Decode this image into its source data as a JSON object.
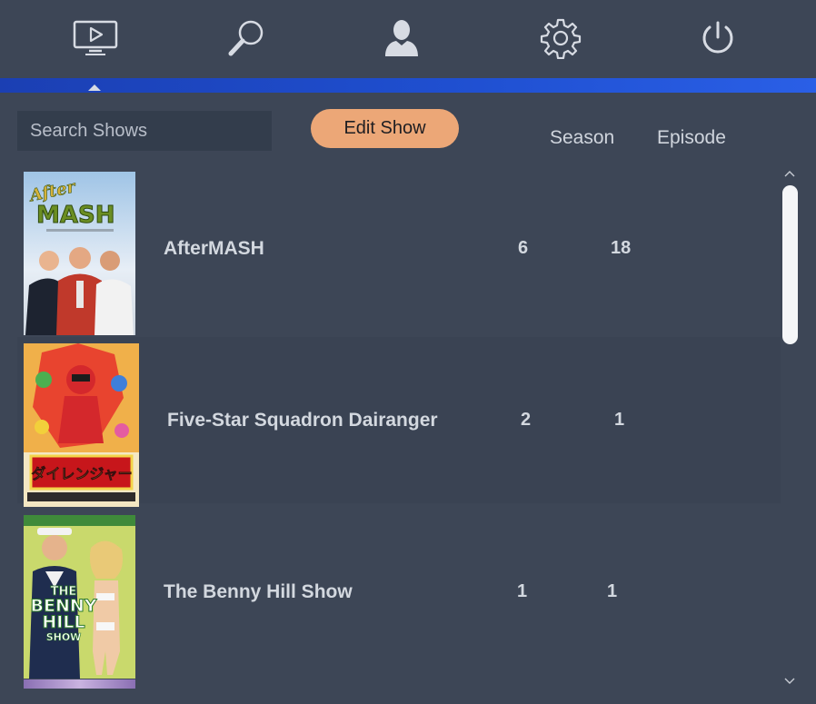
{
  "nav": {
    "items": [
      {
        "name": "tv-shows",
        "icon": "tv-play-icon",
        "active": true
      },
      {
        "name": "search",
        "icon": "magnifier-icon",
        "active": false
      },
      {
        "name": "profile",
        "icon": "user-icon",
        "active": false
      },
      {
        "name": "settings",
        "icon": "gear-icon",
        "active": false
      },
      {
        "name": "power",
        "icon": "power-icon",
        "active": false
      }
    ],
    "accent_color": "#1f4fd0"
  },
  "toolbar": {
    "search_placeholder": "Search Shows",
    "edit_label": "Edit Show",
    "edit_color": "#eca777"
  },
  "columns": {
    "season": "Season",
    "episode": "Episode"
  },
  "shows": [
    {
      "title": "AfterMASH",
      "season": "6",
      "episode": "18",
      "poster_icon": "aftermash-poster"
    },
    {
      "title": "Five-Star Squadron Dairanger",
      "season": "2",
      "episode": "1",
      "poster_icon": "dairanger-poster"
    },
    {
      "title": "The Benny Hill Show",
      "season": "1",
      "episode": "1",
      "poster_icon": "benny-hill-poster"
    }
  ],
  "scrollbar": {
    "up_icon": "chevron-up-icon",
    "down_icon": "chevron-down-icon"
  }
}
